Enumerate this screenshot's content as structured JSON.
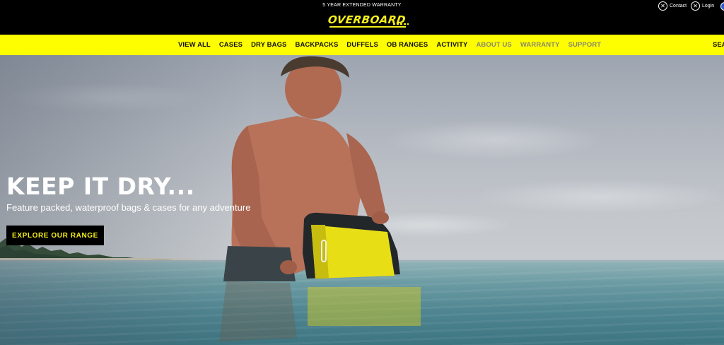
{
  "header": {
    "announcement": "5 YEAR EXTENDED WARRANTY",
    "logo_text": "OVERBOARD",
    "utility": {
      "contact_label": "Contact",
      "contact_icon": "contact-icon",
      "login_label": "Login",
      "login_icon": "login-icon"
    }
  },
  "nav": {
    "items": [
      {
        "label": "VIEW ALL",
        "muted": false
      },
      {
        "label": "CASES",
        "muted": false
      },
      {
        "label": "DRY BAGS",
        "muted": false
      },
      {
        "label": "BACKPACKS",
        "muted": false
      },
      {
        "label": "DUFFELS",
        "muted": false
      },
      {
        "label": "OB RANGES",
        "muted": false
      },
      {
        "label": "ACTIVITY",
        "muted": false
      },
      {
        "label": "ABOUT US",
        "muted": true
      },
      {
        "label": "WARRANTY",
        "muted": true
      },
      {
        "label": "SUPPORT",
        "muted": true
      }
    ],
    "search_label": "SEA"
  },
  "hero": {
    "headline": "KEEP IT DRY...",
    "subheadline": "Feature packed, waterproof bags & cases for any adventure",
    "cta_label": "EXPLORE OUR RANGE"
  },
  "colors": {
    "brand_yellow": "#fefe00",
    "logo_yellow": "#f5ef1c",
    "header_black": "#000000"
  }
}
